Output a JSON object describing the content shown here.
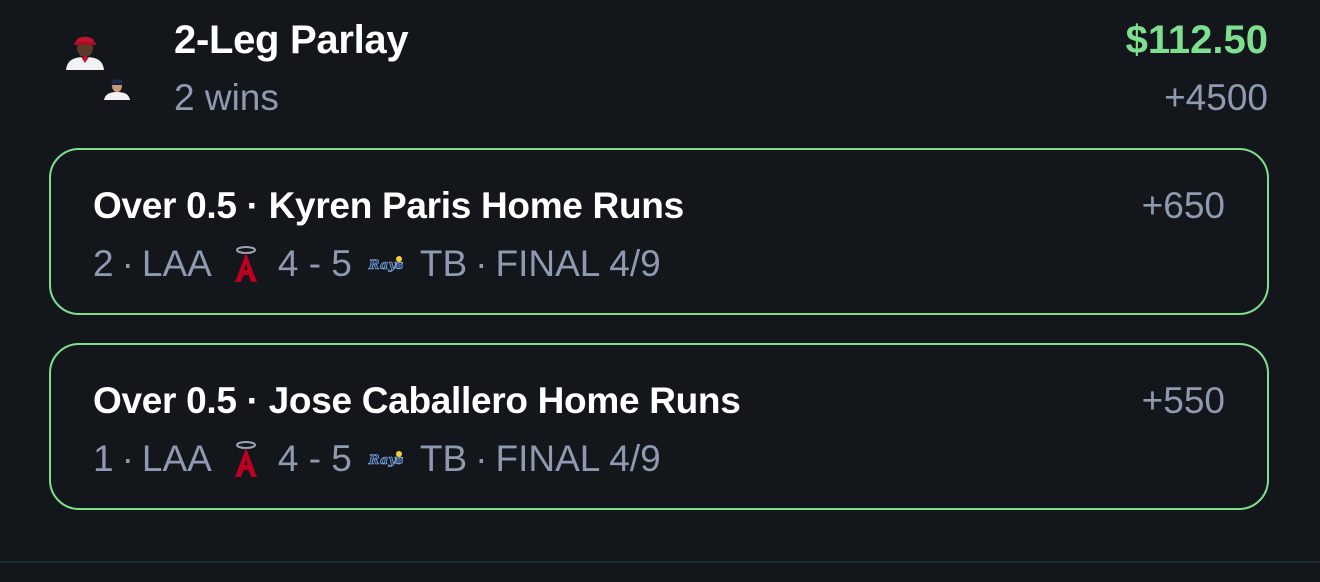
{
  "parlay": {
    "title": "2-Leg Parlay",
    "subtitle": "2 wins",
    "payout": "$112.50",
    "odds": "+4500"
  },
  "legs": [
    {
      "title": "Over 0.5 · Kyren Paris Home Runs",
      "odds": "+650",
      "result": "2",
      "away_team": "LAA",
      "score": "4 - 5",
      "home_team": "TB",
      "status": "FINAL 4/9"
    },
    {
      "title": "Over 0.5 · Jose Caballero Home Runs",
      "odds": "+550",
      "result": "1",
      "away_team": "LAA",
      "score": "4 - 5",
      "home_team": "TB",
      "status": "FINAL 4/9"
    }
  ],
  "icons": {
    "avatar_a": "player-avatar-icon",
    "avatar_b": "player-avatar-icon",
    "away_logo": "angels-logo-icon",
    "home_logo": "rays-logo-icon"
  },
  "colors": {
    "background": "#13161b",
    "win_green": "#7ee08f",
    "muted_text": "#8f9ab0",
    "primary_text": "#ffffff"
  }
}
